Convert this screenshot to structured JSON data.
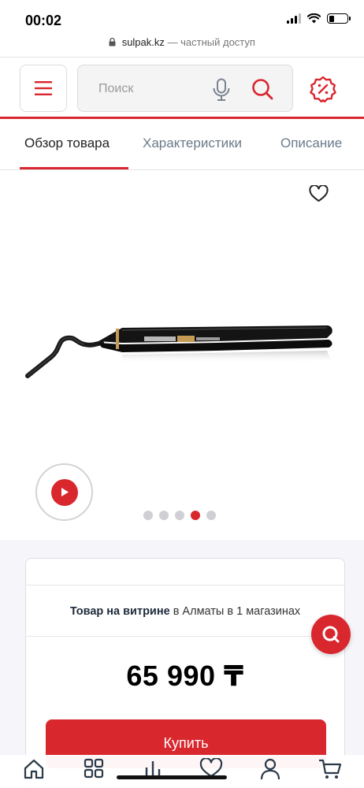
{
  "status_bar": {
    "time": "00:02",
    "battery_level": 0.3
  },
  "url_bar": {
    "domain": "sulpak.kz",
    "suffix": "— частный доступ"
  },
  "header": {
    "search_placeholder": "Поиск",
    "icons": [
      "menu-icon",
      "mic-icon",
      "search-icon",
      "percent-badge-icon"
    ]
  },
  "tabs": [
    {
      "label": "Обзор товара",
      "active": true
    },
    {
      "label": "Характеристики",
      "active": false
    },
    {
      "label": "Описание",
      "active": false
    }
  ],
  "gallery": {
    "image_count": 5,
    "active_index": 3
  },
  "info": {
    "stock_bold": "Товар на витрине",
    "stock_rest": " в Алматы в 1 магазинах",
    "price": "65 990 ₸",
    "buy_label": "Купить"
  },
  "bottom_nav": [
    "home-icon",
    "catalog-icon",
    "compare-icon",
    "favorites-icon",
    "profile-icon",
    "cart-icon"
  ],
  "colors": {
    "accent": "#d9272e",
    "text_dark": "#1e2a3a",
    "muted": "#6a7a8a"
  }
}
